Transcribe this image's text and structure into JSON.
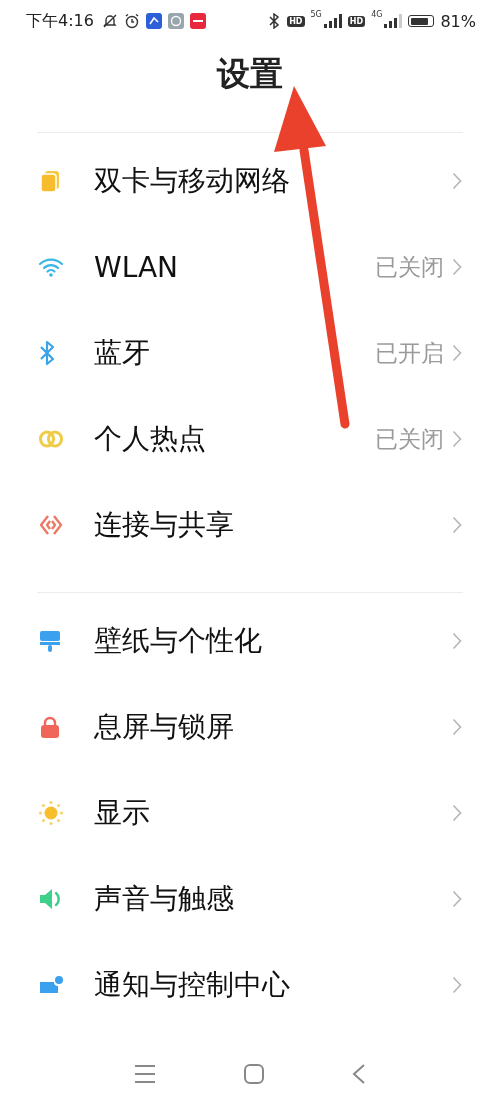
{
  "status_bar": {
    "time": "下午4:16",
    "sim1_badge": "HD",
    "sim1_network": "5G",
    "sim2_badge": "HD",
    "sim2_network": "4G",
    "battery": "81%"
  },
  "title": "设置",
  "sections": [
    {
      "items": [
        {
          "label": "双卡与移动网络"
        },
        {
          "label": "WLAN",
          "value": "已关闭"
        },
        {
          "label": "蓝牙",
          "value": "已开启"
        },
        {
          "label": "个人热点",
          "value": "已关闭"
        },
        {
          "label": "连接与共享"
        }
      ]
    },
    {
      "items": [
        {
          "label": "壁纸与个性化"
        },
        {
          "label": "息屏与锁屏"
        },
        {
          "label": "显示"
        },
        {
          "label": "声音与触感"
        },
        {
          "label": "通知与控制中心"
        }
      ]
    }
  ],
  "annotation": {
    "kind": "arrow"
  }
}
